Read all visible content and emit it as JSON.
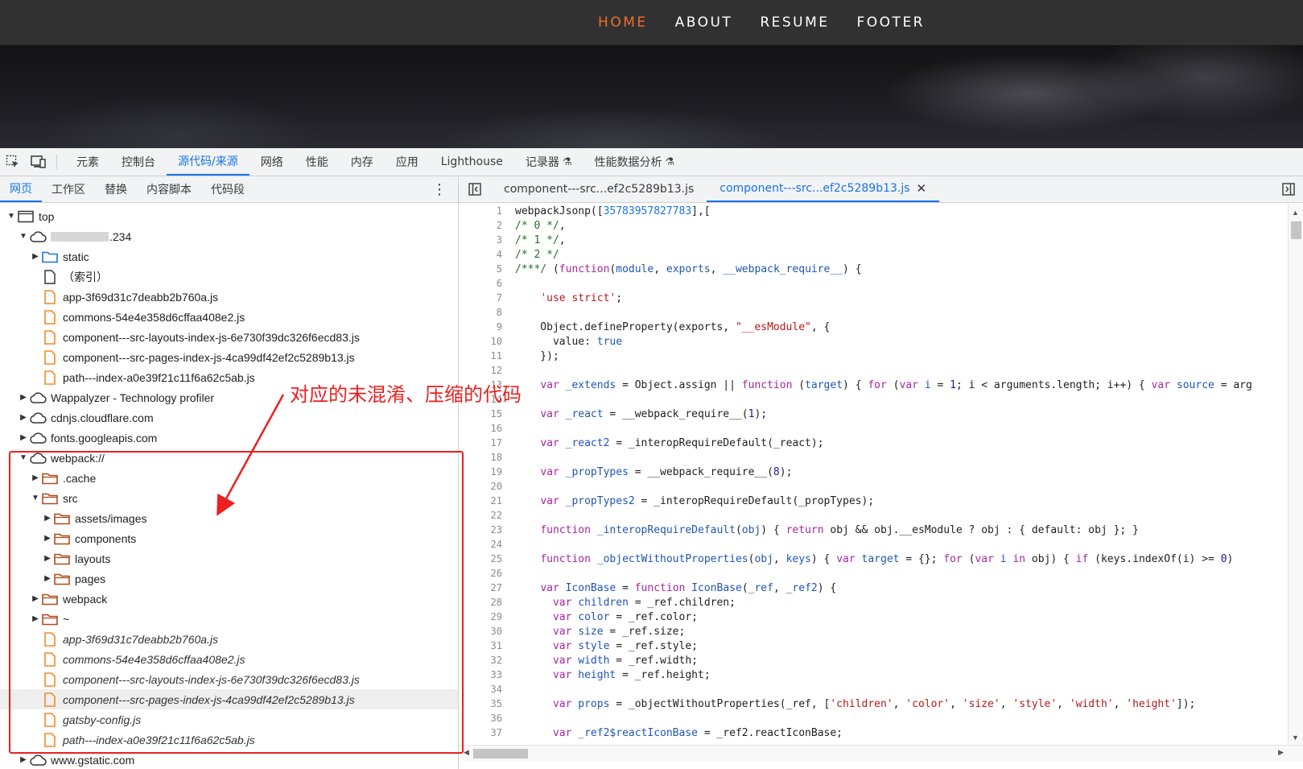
{
  "site": {
    "nav": [
      {
        "label": "HOME",
        "active": true
      },
      {
        "label": "ABOUT",
        "active": false
      },
      {
        "label": "RESUME",
        "active": false
      },
      {
        "label": "FOOTER",
        "active": false
      }
    ],
    "accent": "#f06d2e"
  },
  "devtools": {
    "main_tabs": [
      {
        "label": "元素",
        "active": false
      },
      {
        "label": "控制台",
        "active": false
      },
      {
        "label": "源代码/来源",
        "active": true
      },
      {
        "label": "网络",
        "active": false
      },
      {
        "label": "性能",
        "active": false
      },
      {
        "label": "内存",
        "active": false
      },
      {
        "label": "应用",
        "active": false
      },
      {
        "label": "Lighthouse",
        "active": false
      },
      {
        "label": "记录器",
        "active": false,
        "flask": true
      },
      {
        "label": "性能数据分析",
        "active": false,
        "flask": true
      }
    ],
    "accent": "#1a73e8"
  },
  "navigator": {
    "tabs": [
      {
        "label": "网页",
        "active": true
      },
      {
        "label": "工作区",
        "active": false
      },
      {
        "label": "替换",
        "active": false
      },
      {
        "label": "内容脚本",
        "active": false
      },
      {
        "label": "代码段",
        "active": false
      }
    ],
    "tree": [
      {
        "label": "top",
        "depth": 0,
        "arrow": "open",
        "icon": "frame-icon"
      },
      {
        "label": ".234",
        "depth": 1,
        "arrow": "open",
        "icon": "cloud-icon",
        "redacted": true
      },
      {
        "label": "static",
        "depth": 2,
        "arrow": "closed",
        "icon": "folder-blue-icon"
      },
      {
        "label": "（索引）",
        "depth": 2,
        "arrow": "none",
        "icon": "file-icon"
      },
      {
        "label": "app-3f69d31c7deabb2b760a.js",
        "depth": 2,
        "arrow": "none",
        "icon": "script-file-icon"
      },
      {
        "label": "commons-54e4e358d6cffaa408e2.js",
        "depth": 2,
        "arrow": "none",
        "icon": "script-file-icon"
      },
      {
        "label": "component---src-layouts-index-js-6e730f39dc326f6ecd83.js",
        "depth": 2,
        "arrow": "none",
        "icon": "script-file-icon"
      },
      {
        "label": "component---src-pages-index-js-4ca99df42ef2c5289b13.js",
        "depth": 2,
        "arrow": "none",
        "icon": "script-file-icon"
      },
      {
        "label": "path---index-a0e39f21c11f6a62c5ab.js",
        "depth": 2,
        "arrow": "none",
        "icon": "script-file-icon"
      },
      {
        "label": "Wappalyzer - Technology profiler",
        "depth": 1,
        "arrow": "closed",
        "icon": "cloud-icon"
      },
      {
        "label": "cdnjs.cloudflare.com",
        "depth": 1,
        "arrow": "closed",
        "icon": "cloud-icon"
      },
      {
        "label": "fonts.googleapis.com",
        "depth": 1,
        "arrow": "closed",
        "icon": "cloud-icon"
      },
      {
        "label": "webpack://",
        "depth": 1,
        "arrow": "open",
        "icon": "cloud-icon"
      },
      {
        "label": ".cache",
        "depth": 2,
        "arrow": "closed",
        "icon": "folder-orange-icon"
      },
      {
        "label": "src",
        "depth": 2,
        "arrow": "open",
        "icon": "folder-orange-icon"
      },
      {
        "label": "assets/images",
        "depth": 3,
        "arrow": "closed",
        "icon": "folder-orange-icon"
      },
      {
        "label": "components",
        "depth": 3,
        "arrow": "closed",
        "icon": "folder-orange-icon"
      },
      {
        "label": "layouts",
        "depth": 3,
        "arrow": "closed",
        "icon": "folder-orange-icon"
      },
      {
        "label": "pages",
        "depth": 3,
        "arrow": "closed",
        "icon": "folder-orange-icon"
      },
      {
        "label": "webpack",
        "depth": 2,
        "arrow": "closed",
        "icon": "folder-orange-icon"
      },
      {
        "label": "~",
        "depth": 2,
        "arrow": "closed",
        "icon": "folder-orange-icon"
      },
      {
        "label": "app-3f69d31c7deabb2b760a.js",
        "depth": 2,
        "arrow": "none",
        "icon": "script-file-icon",
        "italic": true
      },
      {
        "label": "commons-54e4e358d6cffaa408e2.js",
        "depth": 2,
        "arrow": "none",
        "icon": "script-file-icon",
        "italic": true
      },
      {
        "label": "component---src-layouts-index-js-6e730f39dc326f6ecd83.js",
        "depth": 2,
        "arrow": "none",
        "icon": "script-file-icon",
        "italic": true
      },
      {
        "label": "component---src-pages-index-js-4ca99df42ef2c5289b13.js",
        "depth": 2,
        "arrow": "none",
        "icon": "script-file-icon",
        "italic": true,
        "selected": true
      },
      {
        "label": "gatsby-config.js",
        "depth": 2,
        "arrow": "none",
        "icon": "script-file-icon",
        "italic": true
      },
      {
        "label": "path---index-a0e39f21c11f6a62c5ab.js",
        "depth": 2,
        "arrow": "none",
        "icon": "script-file-icon",
        "italic": true
      },
      {
        "label": "www.gstatic.com",
        "depth": 1,
        "arrow": "closed",
        "icon": "cloud-icon"
      }
    ]
  },
  "editor": {
    "tabs": [
      {
        "label": "component---src...ef2c5289b13.js",
        "active": false
      },
      {
        "label": "component---src...ef2c5289b13.js",
        "active": true,
        "closable": true
      }
    ],
    "lines": [
      {
        "n": "1",
        "html": "webpackJsonp([<span class=\"num2\">35783957827783</span>],["
      },
      {
        "n": "2",
        "html": "<span class=\"cmt\">/* 0 */</span>,"
      },
      {
        "n": "3",
        "html": "<span class=\"cmt\">/* 1 */</span>,"
      },
      {
        "n": "4",
        "html": "<span class=\"cmt\">/* 2 */</span>"
      },
      {
        "n": "5",
        "html": "<span class=\"cmt\">/***/</span> (<span class=\"kw\">function</span>(<span class=\"def\">module</span>, <span class=\"def\">exports</span>, <span class=\"def\">__webpack_require__</span>) {"
      },
      {
        "n": "6",
        "html": ""
      },
      {
        "n": "7",
        "html": "    <span class=\"str\">'use strict'</span>;"
      },
      {
        "n": "8",
        "html": ""
      },
      {
        "n": "9",
        "html": "    Object.defineProperty(exports, <span class=\"str\">\"__esModule\"</span>, {"
      },
      {
        "n": "10",
        "html": "      value: <span class=\"kw2\">true</span>"
      },
      {
        "n": "11",
        "html": "    });"
      },
      {
        "n": "12",
        "html": ""
      },
      {
        "n": "13",
        "html": "    <span class=\"kw\">var</span> <span class=\"def\">_extends</span> = Object.assign || <span class=\"kw\">function</span> (<span class=\"def\">target</span>) { <span class=\"kw\">for</span> (<span class=\"kw\">var</span> <span class=\"def\">i</span> = <span class=\"num\">1</span>; i &lt; arguments.length; i++) { <span class=\"kw\">var</span> <span class=\"def\">source</span> = arg"
      },
      {
        "n": "14",
        "html": ""
      },
      {
        "n": "15",
        "html": "    <span class=\"kw\">var</span> <span class=\"def\">_react</span> = __webpack_require__(<span class=\"num\">1</span>);"
      },
      {
        "n": "16",
        "html": ""
      },
      {
        "n": "17",
        "html": "    <span class=\"kw\">var</span> <span class=\"def\">_react2</span> = _interopRequireDefault(_react);"
      },
      {
        "n": "18",
        "html": ""
      },
      {
        "n": "19",
        "html": "    <span class=\"kw\">var</span> <span class=\"def\">_propTypes</span> = __webpack_require__(<span class=\"num\">8</span>);"
      },
      {
        "n": "20",
        "html": ""
      },
      {
        "n": "21",
        "html": "    <span class=\"kw\">var</span> <span class=\"def\">_propTypes2</span> = _interopRequireDefault(_propTypes);"
      },
      {
        "n": "22",
        "html": ""
      },
      {
        "n": "23",
        "html": "    <span class=\"kw\">function</span> <span class=\"def\">_interopRequireDefault</span>(<span class=\"def\">obj</span>) { <span class=\"kw\">return</span> obj &amp;&amp; obj.__esModule ? obj : { default: obj }; }"
      },
      {
        "n": "24",
        "html": ""
      },
      {
        "n": "25",
        "html": "    <span class=\"kw\">function</span> <span class=\"def\">_objectWithoutProperties</span>(<span class=\"def\">obj</span>, <span class=\"def\">keys</span>) { <span class=\"kw\">var</span> <span class=\"def\">target</span> = {}; <span class=\"kw\">for</span> (<span class=\"kw\">var</span> <span class=\"def\">i</span> <span class=\"kw\">in</span> obj) { <span class=\"kw\">if</span> (keys.indexOf(i) &gt;= <span class=\"num\">0</span>)"
      },
      {
        "n": "26",
        "html": ""
      },
      {
        "n": "27",
        "html": "    <span class=\"kw\">var</span> <span class=\"def\">IconBase</span> = <span class=\"kw\">function</span> <span class=\"def\">IconBase</span>(<span class=\"def\">_ref</span>, <span class=\"def\">_ref2</span>) {"
      },
      {
        "n": "28",
        "html": "      <span class=\"kw\">var</span> <span class=\"def\">children</span> = _ref.children;"
      },
      {
        "n": "29",
        "html": "      <span class=\"kw\">var</span> <span class=\"def\">color</span> = _ref.color;"
      },
      {
        "n": "30",
        "html": "      <span class=\"kw\">var</span> <span class=\"def\">size</span> = _ref.size;"
      },
      {
        "n": "31",
        "html": "      <span class=\"kw\">var</span> <span class=\"def\">style</span> = _ref.style;"
      },
      {
        "n": "32",
        "html": "      <span class=\"kw\">var</span> <span class=\"def\">width</span> = _ref.width;"
      },
      {
        "n": "33",
        "html": "      <span class=\"kw\">var</span> <span class=\"def\">height</span> = _ref.height;"
      },
      {
        "n": "34",
        "html": ""
      },
      {
        "n": "35",
        "html": "      <span class=\"kw\">var</span> <span class=\"def\">props</span> = _objectWithoutProperties(_ref, [<span class=\"str\">'children'</span>, <span class=\"str\">'color'</span>, <span class=\"str\">'size'</span>, <span class=\"str\">'style'</span>, <span class=\"str\">'width'</span>, <span class=\"str\">'height'</span>]);"
      },
      {
        "n": "36",
        "html": ""
      },
      {
        "n": "37",
        "html": "      <span class=\"kw\">var</span> <span class=\"def\">_ref2$reactIconBase</span> = _ref2.reactIconBase;"
      }
    ]
  },
  "annotation": {
    "text": "对应的未混淆、压缩的代码",
    "color": "#ee1f1f"
  }
}
